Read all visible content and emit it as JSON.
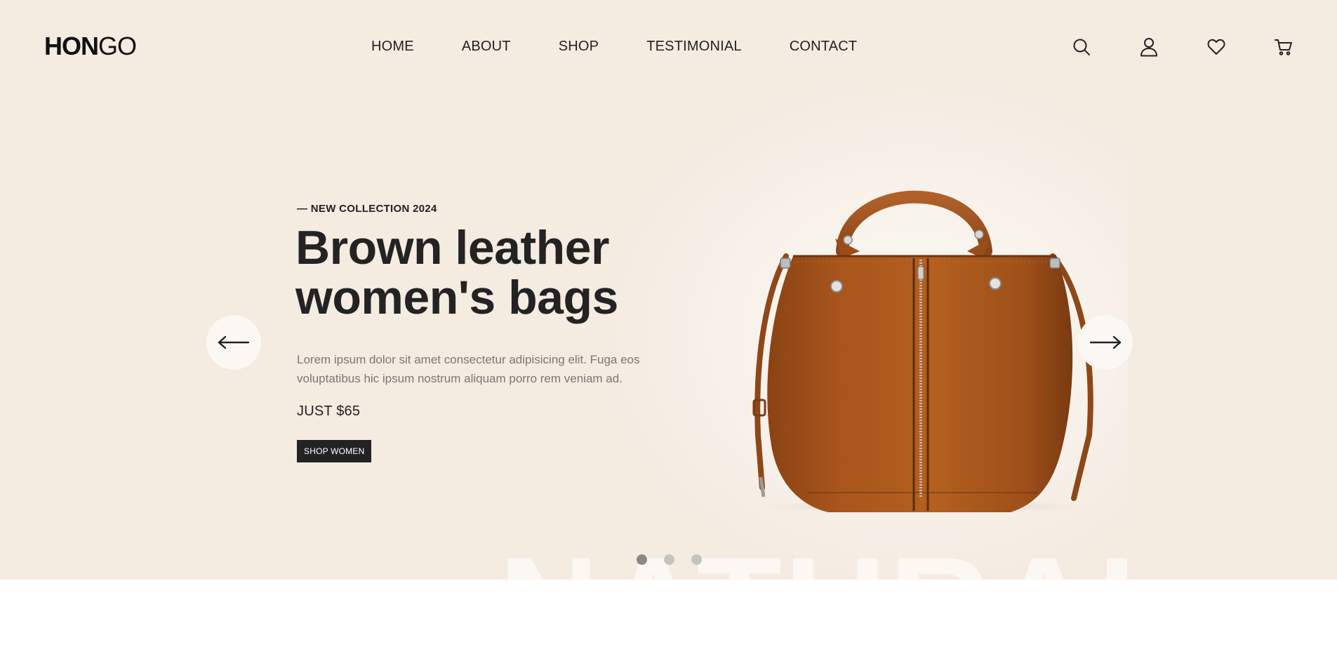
{
  "header": {
    "logo_bold": "HON",
    "logo_light": "GO",
    "nav": [
      {
        "label": "HOME"
      },
      {
        "label": "ABOUT"
      },
      {
        "label": "SHOP"
      },
      {
        "label": "TESTIMONIAL"
      },
      {
        "label": "CONTACT"
      }
    ],
    "icons": [
      "search-icon",
      "user-icon",
      "heart-icon",
      "cart-icon"
    ]
  },
  "hero": {
    "eyebrow": "— NEW COLLECTION 2024",
    "headline": "Brown leather women's bags",
    "description": "Lorem ipsum dolor sit amet consectetur adipisicing elit. Fuga eos voluptatibus hic ipsum nostrum aliquam porro rem veniam ad.",
    "price": "JUST $65",
    "cta_label": "SHOP WOMEN",
    "watermark": "NATURAL",
    "arrow_prev_icon": "arrow-left-icon",
    "arrow_next_icon": "arrow-right-icon",
    "slide_count": 3,
    "active_slide": 1
  },
  "colors": {
    "hero_background": "#f4ebe1",
    "text_dark": "#232323",
    "text_muted": "#7a7775",
    "button_background": "#232323",
    "bag_leather": "#a9561c",
    "dot_active": "#8a8887",
    "dot_inactive": "#c5c3c1"
  }
}
